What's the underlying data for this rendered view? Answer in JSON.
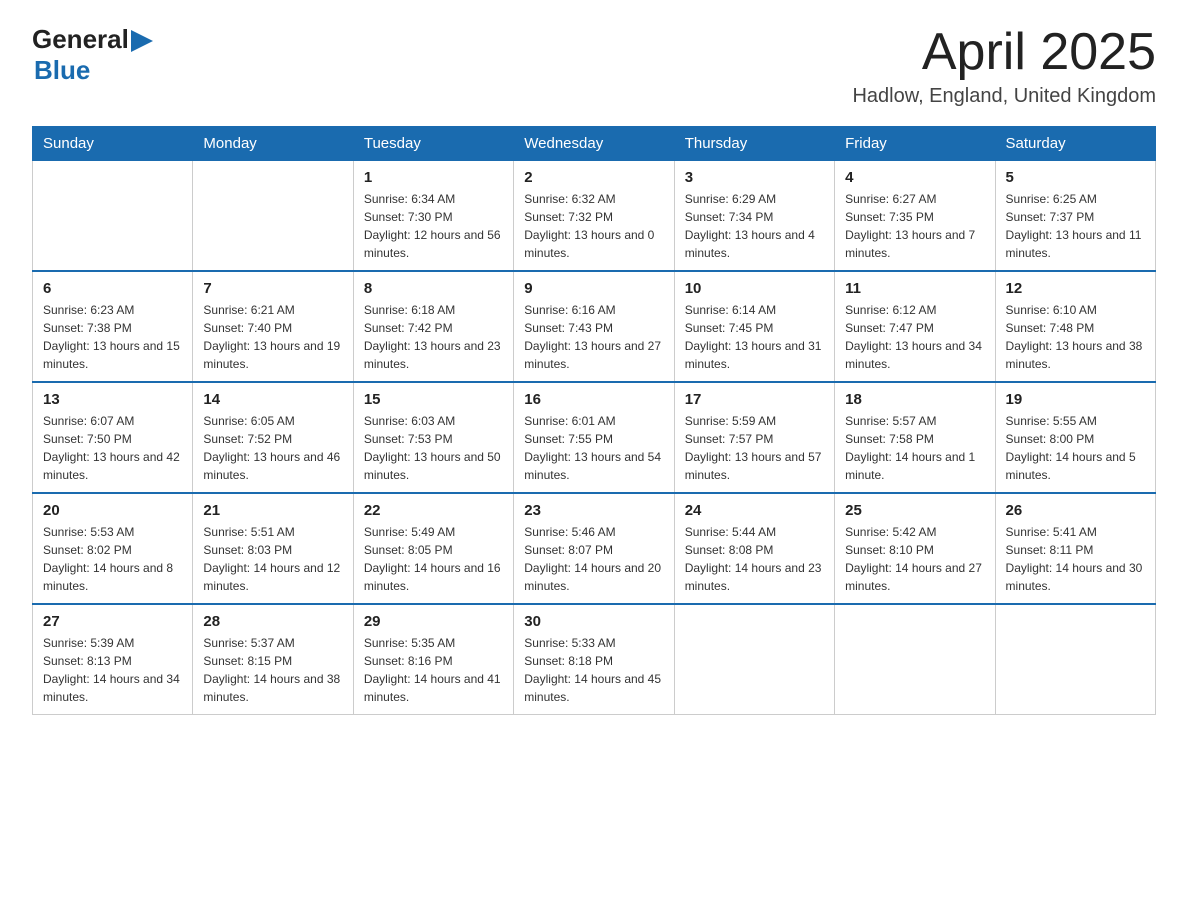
{
  "header": {
    "title": "April 2025",
    "subtitle": "Hadlow, England, United Kingdom",
    "logo_general": "General",
    "logo_blue": "Blue"
  },
  "days_of_week": [
    "Sunday",
    "Monday",
    "Tuesday",
    "Wednesday",
    "Thursday",
    "Friday",
    "Saturday"
  ],
  "weeks": [
    [
      {
        "day": "",
        "sunrise": "",
        "sunset": "",
        "daylight": ""
      },
      {
        "day": "",
        "sunrise": "",
        "sunset": "",
        "daylight": ""
      },
      {
        "day": "1",
        "sunrise": "Sunrise: 6:34 AM",
        "sunset": "Sunset: 7:30 PM",
        "daylight": "Daylight: 12 hours and 56 minutes."
      },
      {
        "day": "2",
        "sunrise": "Sunrise: 6:32 AM",
        "sunset": "Sunset: 7:32 PM",
        "daylight": "Daylight: 13 hours and 0 minutes."
      },
      {
        "day": "3",
        "sunrise": "Sunrise: 6:29 AM",
        "sunset": "Sunset: 7:34 PM",
        "daylight": "Daylight: 13 hours and 4 minutes."
      },
      {
        "day": "4",
        "sunrise": "Sunrise: 6:27 AM",
        "sunset": "Sunset: 7:35 PM",
        "daylight": "Daylight: 13 hours and 7 minutes."
      },
      {
        "day": "5",
        "sunrise": "Sunrise: 6:25 AM",
        "sunset": "Sunset: 7:37 PM",
        "daylight": "Daylight: 13 hours and 11 minutes."
      }
    ],
    [
      {
        "day": "6",
        "sunrise": "Sunrise: 6:23 AM",
        "sunset": "Sunset: 7:38 PM",
        "daylight": "Daylight: 13 hours and 15 minutes."
      },
      {
        "day": "7",
        "sunrise": "Sunrise: 6:21 AM",
        "sunset": "Sunset: 7:40 PM",
        "daylight": "Daylight: 13 hours and 19 minutes."
      },
      {
        "day": "8",
        "sunrise": "Sunrise: 6:18 AM",
        "sunset": "Sunset: 7:42 PM",
        "daylight": "Daylight: 13 hours and 23 minutes."
      },
      {
        "day": "9",
        "sunrise": "Sunrise: 6:16 AM",
        "sunset": "Sunset: 7:43 PM",
        "daylight": "Daylight: 13 hours and 27 minutes."
      },
      {
        "day": "10",
        "sunrise": "Sunrise: 6:14 AM",
        "sunset": "Sunset: 7:45 PM",
        "daylight": "Daylight: 13 hours and 31 minutes."
      },
      {
        "day": "11",
        "sunrise": "Sunrise: 6:12 AM",
        "sunset": "Sunset: 7:47 PM",
        "daylight": "Daylight: 13 hours and 34 minutes."
      },
      {
        "day": "12",
        "sunrise": "Sunrise: 6:10 AM",
        "sunset": "Sunset: 7:48 PM",
        "daylight": "Daylight: 13 hours and 38 minutes."
      }
    ],
    [
      {
        "day": "13",
        "sunrise": "Sunrise: 6:07 AM",
        "sunset": "Sunset: 7:50 PM",
        "daylight": "Daylight: 13 hours and 42 minutes."
      },
      {
        "day": "14",
        "sunrise": "Sunrise: 6:05 AM",
        "sunset": "Sunset: 7:52 PM",
        "daylight": "Daylight: 13 hours and 46 minutes."
      },
      {
        "day": "15",
        "sunrise": "Sunrise: 6:03 AM",
        "sunset": "Sunset: 7:53 PM",
        "daylight": "Daylight: 13 hours and 50 minutes."
      },
      {
        "day": "16",
        "sunrise": "Sunrise: 6:01 AM",
        "sunset": "Sunset: 7:55 PM",
        "daylight": "Daylight: 13 hours and 54 minutes."
      },
      {
        "day": "17",
        "sunrise": "Sunrise: 5:59 AM",
        "sunset": "Sunset: 7:57 PM",
        "daylight": "Daylight: 13 hours and 57 minutes."
      },
      {
        "day": "18",
        "sunrise": "Sunrise: 5:57 AM",
        "sunset": "Sunset: 7:58 PM",
        "daylight": "Daylight: 14 hours and 1 minute."
      },
      {
        "day": "19",
        "sunrise": "Sunrise: 5:55 AM",
        "sunset": "Sunset: 8:00 PM",
        "daylight": "Daylight: 14 hours and 5 minutes."
      }
    ],
    [
      {
        "day": "20",
        "sunrise": "Sunrise: 5:53 AM",
        "sunset": "Sunset: 8:02 PM",
        "daylight": "Daylight: 14 hours and 8 minutes."
      },
      {
        "day": "21",
        "sunrise": "Sunrise: 5:51 AM",
        "sunset": "Sunset: 8:03 PM",
        "daylight": "Daylight: 14 hours and 12 minutes."
      },
      {
        "day": "22",
        "sunrise": "Sunrise: 5:49 AM",
        "sunset": "Sunset: 8:05 PM",
        "daylight": "Daylight: 14 hours and 16 minutes."
      },
      {
        "day": "23",
        "sunrise": "Sunrise: 5:46 AM",
        "sunset": "Sunset: 8:07 PM",
        "daylight": "Daylight: 14 hours and 20 minutes."
      },
      {
        "day": "24",
        "sunrise": "Sunrise: 5:44 AM",
        "sunset": "Sunset: 8:08 PM",
        "daylight": "Daylight: 14 hours and 23 minutes."
      },
      {
        "day": "25",
        "sunrise": "Sunrise: 5:42 AM",
        "sunset": "Sunset: 8:10 PM",
        "daylight": "Daylight: 14 hours and 27 minutes."
      },
      {
        "day": "26",
        "sunrise": "Sunrise: 5:41 AM",
        "sunset": "Sunset: 8:11 PM",
        "daylight": "Daylight: 14 hours and 30 minutes."
      }
    ],
    [
      {
        "day": "27",
        "sunrise": "Sunrise: 5:39 AM",
        "sunset": "Sunset: 8:13 PM",
        "daylight": "Daylight: 14 hours and 34 minutes."
      },
      {
        "day": "28",
        "sunrise": "Sunrise: 5:37 AM",
        "sunset": "Sunset: 8:15 PM",
        "daylight": "Daylight: 14 hours and 38 minutes."
      },
      {
        "day": "29",
        "sunrise": "Sunrise: 5:35 AM",
        "sunset": "Sunset: 8:16 PM",
        "daylight": "Daylight: 14 hours and 41 minutes."
      },
      {
        "day": "30",
        "sunrise": "Sunrise: 5:33 AM",
        "sunset": "Sunset: 8:18 PM",
        "daylight": "Daylight: 14 hours and 45 minutes."
      },
      {
        "day": "",
        "sunrise": "",
        "sunset": "",
        "daylight": ""
      },
      {
        "day": "",
        "sunrise": "",
        "sunset": "",
        "daylight": ""
      },
      {
        "day": "",
        "sunrise": "",
        "sunset": "",
        "daylight": ""
      }
    ]
  ]
}
